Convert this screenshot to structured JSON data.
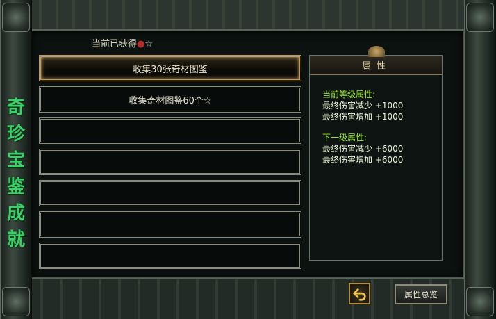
{
  "side_title": [
    "奇",
    "珍",
    "宝",
    "鉴",
    "成",
    "就"
  ],
  "obtained": {
    "label": "当前已获得",
    "dot": "●",
    "star": "☆"
  },
  "list": {
    "items": [
      {
        "label": "收集30张奇材图鉴",
        "selected": true
      },
      {
        "label": "收集奇材图鉴60个☆",
        "selected": false
      },
      {
        "label": "",
        "selected": false
      },
      {
        "label": "",
        "selected": false
      },
      {
        "label": "",
        "selected": false
      },
      {
        "label": "",
        "selected": false
      },
      {
        "label": "",
        "selected": false
      }
    ]
  },
  "attributes": {
    "title": "属性",
    "current_header": "当前等级属性:",
    "current": [
      "最终伤害减少 +1000",
      "最终伤害增加 +1000"
    ],
    "next_header": "下一级属性:",
    "next": [
      "最终伤害减少 +6000",
      "最终伤害增加 +6000"
    ]
  },
  "buttons": {
    "back_icon": "back-arrow-icon",
    "overview": "属性总览"
  },
  "colors": {
    "title_green": "#3bd06a",
    "attr_header_green": "#9be72a",
    "selected_gold": "#c19b55"
  }
}
